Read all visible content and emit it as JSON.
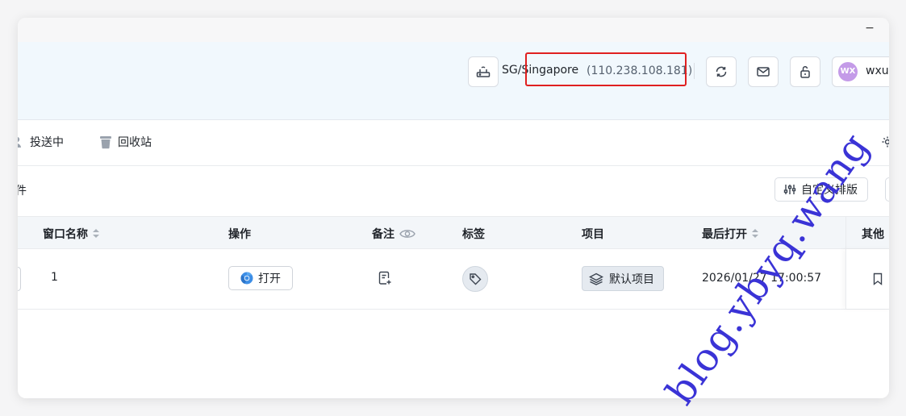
{
  "window": {
    "minimize_glyph": "−"
  },
  "header": {
    "proxy": {
      "label": "SG/Singapore",
      "ip": "(110.238.108.181)",
      "icon": "router-icon"
    },
    "buttons": [
      "refresh-icon",
      "mail-icon",
      "unlock-icon"
    ],
    "user": {
      "initials": "WX",
      "name": "wxu"
    }
  },
  "tabs": [
    {
      "label": "投送中",
      "icon": "user-icon"
    },
    {
      "label": "回收站",
      "icon": "trash-icon"
    }
  ],
  "toolbar": {
    "partial_text": "件",
    "custom_sort_label": "自定义排版"
  },
  "table": {
    "columns": {
      "name": "窗口名称",
      "action": "操作",
      "note": "备注",
      "tag": "标签",
      "project": "项目",
      "last_open": "最后打开",
      "other": "其他"
    },
    "rows": [
      {
        "name": "1",
        "open_label": "打开",
        "project": "默认项目",
        "last_open": "2026/01/27 17:00:57"
      }
    ]
  },
  "watermark": "blog.ybyq.wang",
  "colors": {
    "header_bg": "#f1f8fd",
    "highlight": "#e02020",
    "avatar": "#c49be8",
    "watermark": "#3a33d6"
  }
}
